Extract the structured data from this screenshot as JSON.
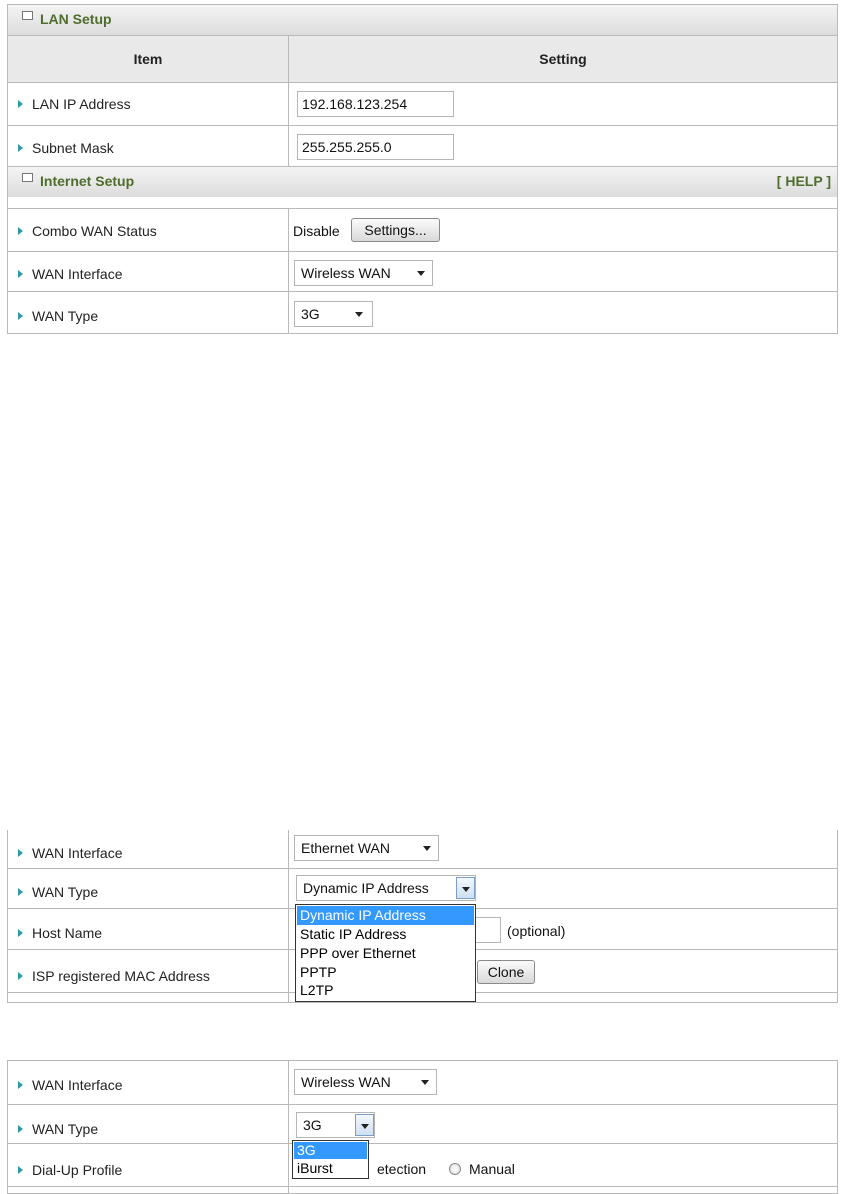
{
  "lan_setup": {
    "title": "LAN Setup",
    "col_item": "Item",
    "col_setting": "Setting",
    "lan_ip_label": "LAN IP Address",
    "lan_ip_value": "192.168.123.254",
    "subnet_label": "Subnet Mask",
    "subnet_value": "255.255.255.0"
  },
  "internet_setup": {
    "title": "Internet Setup",
    "help": "[ HELP ]",
    "combo_label": "Combo WAN Status",
    "combo_status": "Disable",
    "settings_button": "Settings...",
    "wan_interface_label": "WAN Interface",
    "wan_interface_value": "Wireless WAN",
    "wan_type_label": "WAN Type",
    "wan_type_value": "3G"
  },
  "ethernet_panel": {
    "wan_interface_label": "WAN Interface",
    "wan_interface_value": "Ethernet WAN",
    "wan_type_label": "WAN Type",
    "wan_type_value": "Dynamic IP Address",
    "wan_type_options": [
      "Dynamic IP Address",
      "Static IP Address",
      "PPP over Ethernet",
      "PPTP",
      "L2TP"
    ],
    "host_name_label": "Host Name",
    "optional_hint": "(optional)",
    "mac_label": "ISP registered MAC Address",
    "clone_button": "Clone"
  },
  "wireless_panel": {
    "wan_interface_label": "WAN Interface",
    "wan_interface_value": "Wireless WAN",
    "wan_type_label": "WAN Type",
    "wan_type_value": "3G",
    "wan_type_options": [
      "3G",
      "iBurst"
    ],
    "dialup_label": "Dial-Up Profile",
    "detection_partial": "etection",
    "manual_label": "Manual"
  },
  "colors": {
    "section_title": "#4f6d2c",
    "arrow": "#2e9aa7",
    "highlight": "#3399ff"
  }
}
